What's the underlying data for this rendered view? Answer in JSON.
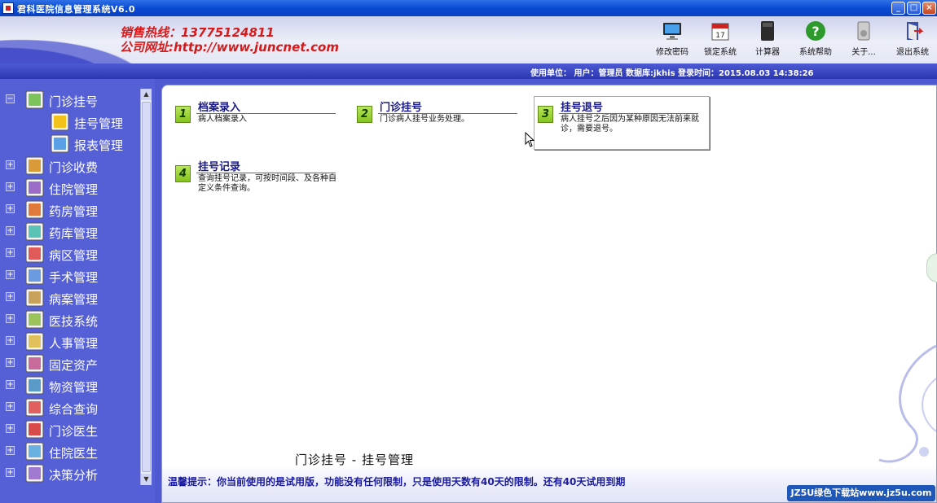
{
  "window": {
    "title": "君科医院信息管理系统V6.0",
    "controls": {
      "minimize": "_",
      "maximize": "□",
      "close": "×"
    }
  },
  "banner": {
    "hotline": "销售热线：13775124811",
    "website": "公司网址:http://www.juncnet.com",
    "info": "使用单位：   用户：管理员   数据库:jkhis 登录时间：2015.08.03 14:38:26"
  },
  "toolbar": [
    {
      "id": "change-password",
      "label": "修改密码",
      "icon": "monitor-icon"
    },
    {
      "id": "lock-system",
      "label": "锁定系统",
      "icon": "calendar-icon"
    },
    {
      "id": "calculator",
      "label": "计算器",
      "icon": "calculator-icon"
    },
    {
      "id": "help",
      "label": "系统帮助",
      "icon": "help-icon"
    },
    {
      "id": "about",
      "label": "关于...",
      "icon": "about-icon"
    },
    {
      "id": "exit",
      "label": "退出系统",
      "icon": "exit-icon"
    }
  ],
  "sidebar": {
    "items": [
      {
        "label": "门诊挂号",
        "expanded": true,
        "icon": "checklist-icon"
      },
      {
        "label": "挂号管理",
        "child": true,
        "icon": "arrow-icon"
      },
      {
        "label": "报表管理",
        "child": true,
        "icon": "report-icon"
      },
      {
        "label": "门诊收费",
        "icon": "cashier-icon"
      },
      {
        "label": "住院管理",
        "icon": "hospital-icon"
      },
      {
        "label": "药房管理",
        "icon": "pharmacy-icon"
      },
      {
        "label": "药库管理",
        "icon": "warehouse-icon"
      },
      {
        "label": "病区管理",
        "icon": "ward-icon"
      },
      {
        "label": "手术管理",
        "icon": "surgery-icon"
      },
      {
        "label": "病案管理",
        "icon": "records-icon"
      },
      {
        "label": "医技系统",
        "icon": "lab-icon"
      },
      {
        "label": "人事管理",
        "icon": "personnel-icon"
      },
      {
        "label": "固定资产",
        "icon": "assets-icon"
      },
      {
        "label": "物资管理",
        "icon": "materials-icon"
      },
      {
        "label": "综合查询",
        "icon": "query-icon"
      },
      {
        "label": "门诊医生",
        "icon": "doctor-icon"
      },
      {
        "label": "住院医生",
        "icon": "inpatient-doctor-icon"
      },
      {
        "label": "决策分析",
        "icon": "analysis-icon"
      }
    ],
    "collapsed_symbol": "+",
    "expanded_symbol": "−"
  },
  "main": {
    "cards": [
      {
        "num": "1",
        "title": "档案录入",
        "desc": "病人档案录入"
      },
      {
        "num": "2",
        "title": "门诊挂号",
        "desc": "门诊病人挂号业务处理。"
      },
      {
        "num": "3",
        "title": "挂号退号",
        "desc": "病人挂号之后因为某种原因无法前来就诊，需要退号。"
      },
      {
        "num": "4",
        "title": "挂号记录",
        "desc": "查询挂号记录，可按时间段、及各种自定义条件查询。"
      }
    ],
    "breadcrumb": "门诊挂号 - 挂号管理",
    "notice": "温馨提示：你当前使用的是试用版，功能没有任何限制，只是使用天数有40天的限制。还有40天试用到期"
  },
  "watermark": "JZ5U绿色下载站www.jz5u.com",
  "colors": {
    "accent": "#4f5ad2",
    "title_bar": "#0a4bd4",
    "hotline": "#d61a1a"
  }
}
